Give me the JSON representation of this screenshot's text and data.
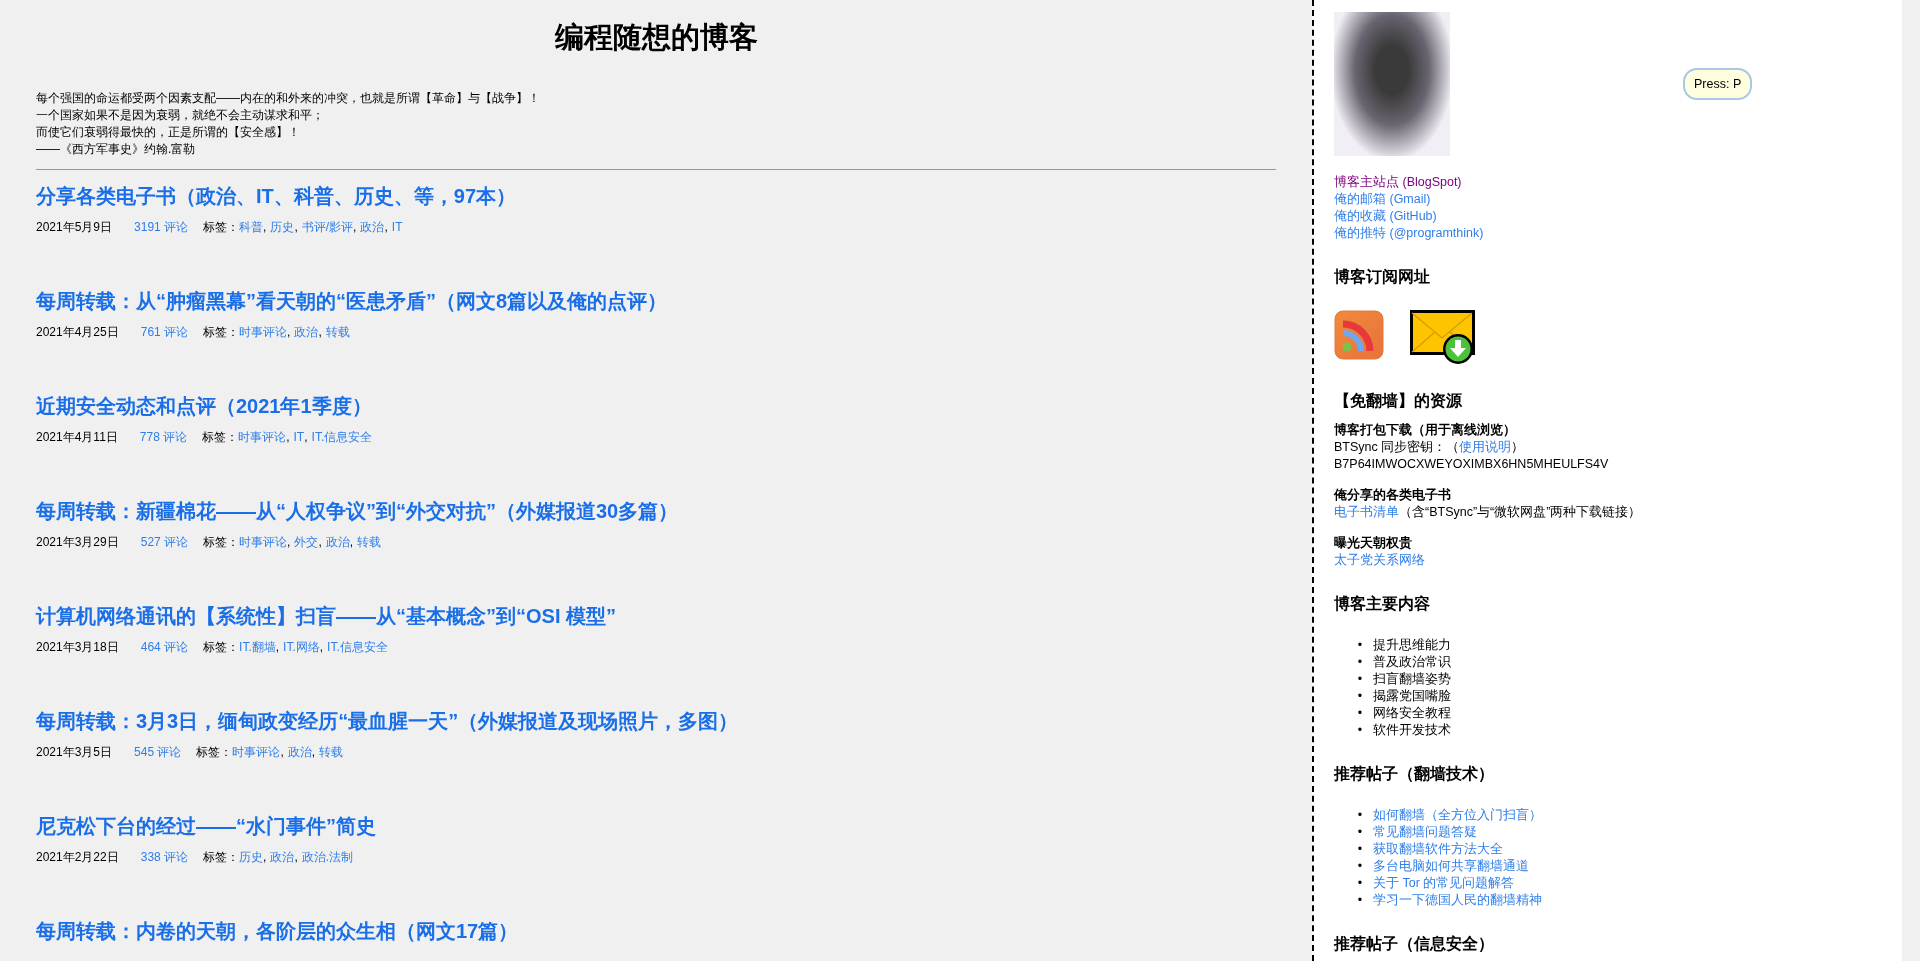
{
  "header": {
    "title": "编程随想的博客",
    "quote_lines": [
      "每个强国的命运都受两个因素支配——内在的和外来的冲突，也就是所谓【革命】与【战争】！",
      "一个国家如果不是因为衰弱，就绝不会主动谋求和平；",
      "而使它们衰弱得最快的，正是所谓的【安全感】！",
      "——《西方军事史》约翰.富勒"
    ]
  },
  "tag_separator": ",",
  "posts": [
    {
      "title": "分享各类电子书（政治、IT、科普、历史、等，97本）",
      "date": "2021年5月9日",
      "comments": "3191 评论",
      "tags_label": "标签：",
      "tags": [
        "科普",
        "历史",
        "书评/影评",
        "政治",
        "IT"
      ]
    },
    {
      "title": "每周转载：从“肿瘤黑幕”看天朝的“医患矛盾”（网文8篇以及俺的点评）",
      "date": "2021年4月25日",
      "comments": "761 评论",
      "tags_label": "标签：",
      "tags": [
        "时事评论",
        "政治",
        "转载"
      ]
    },
    {
      "title": "近期安全动态和点评（2021年1季度）",
      "date": "2021年4月11日",
      "comments": "778 评论",
      "tags_label": "标签：",
      "tags": [
        "时事评论",
        "IT",
        "IT.信息安全"
      ]
    },
    {
      "title": "每周转载：新疆棉花——从“人权争议”到“外交对抗”（外媒报道30多篇）",
      "date": "2021年3月29日",
      "comments": "527 评论",
      "tags_label": "标签：",
      "tags": [
        "时事评论",
        "外交",
        "政治",
        "转载"
      ]
    },
    {
      "title": "计算机网络通讯的【系统性】扫盲——从“基本概念”到“OSI 模型”",
      "date": "2021年3月18日",
      "comments": "464 评论",
      "tags_label": "标签：",
      "tags": [
        "IT.翻墙",
        "IT.网络",
        "IT.信息安全"
      ]
    },
    {
      "title": "每周转载：3月3日，缅甸政变经历“最血腥一天”（外媒报道及现场照片，多图）",
      "date": "2021年3月5日",
      "comments": "545 评论",
      "tags_label": "标签：",
      "tags": [
        "时事评论",
        "政治",
        "转载"
      ]
    },
    {
      "title": "尼克松下台的经过——“水门事件”简史",
      "date": "2021年2月22日",
      "comments": "338 评论",
      "tags_label": "标签：",
      "tags": [
        "历史",
        "政治",
        "政治.法制"
      ]
    },
    {
      "title": "每周转载：内卷的天朝，各阶层的众生相（网文17篇）"
    }
  ],
  "tooltip": {
    "text": "Press: P"
  },
  "sidebar": {
    "links": [
      {
        "text": "博客主站点 (BlogSpot)",
        "visited": true
      },
      {
        "text": "俺的邮箱 (Gmail)",
        "visited": false
      },
      {
        "text": "俺的收藏 (GitHub)",
        "visited": false
      },
      {
        "text": "俺的推特 (@programthink)",
        "visited": false
      }
    ],
    "sections": [
      {
        "kind": "icons",
        "heading": "博客订阅网址",
        "icons": [
          {
            "kind": "rss"
          },
          {
            "kind": "mail"
          }
        ]
      },
      {
        "kind": "resources",
        "heading": "【免翻墙】的资源",
        "blocks": [
          {
            "heading": "博客打包下载（用于离线浏览）",
            "lines": [
              [
                {
                  "text": "BTSync 同步密钥：（",
                  "link": false
                },
                {
                  "text": "使用说明",
                  "link": true
                },
                {
                  "text": "）",
                  "link": false
                }
              ],
              [
                {
                  "text": "B7P64IMWOCXWEYOXIMBX6HN5MHEULFS4V",
                  "link": false
                }
              ]
            ]
          },
          {
            "heading": "俺分享的各类电子书",
            "lines": [
              [
                {
                  "text": "电子书清单",
                  "link": true
                },
                {
                  "text": "（含“BTSync”与“微软网盘”两种下载链接）",
                  "link": false
                }
              ]
            ]
          },
          {
            "heading": "曝光天朝权贵",
            "lines": [
              [
                {
                  "text": "太子党关系网络",
                  "link": true
                }
              ]
            ]
          }
        ]
      },
      {
        "kind": "list",
        "heading": "博客主要内容",
        "bullet": "•",
        "items": [
          {
            "text": "提升思维能力",
            "link": false
          },
          {
            "text": "普及政治常识",
            "link": false
          },
          {
            "text": "扫盲翻墙姿势",
            "link": false
          },
          {
            "text": "揭露党国嘴脸",
            "link": false
          },
          {
            "text": "网络安全教程",
            "link": false
          },
          {
            "text": "软件开发技术",
            "link": false
          }
        ]
      },
      {
        "kind": "list",
        "heading": "推荐帖子（翻墙技术）",
        "bullet": "•",
        "items": [
          {
            "text": "如何翻墙（全方位入门扫盲）",
            "link": true
          },
          {
            "text": "常见翻墙问题答疑",
            "link": true
          },
          {
            "text": "获取翻墙软件方法大全",
            "link": true
          },
          {
            "text": "多台电脑如何共享翻墙通道",
            "link": true
          },
          {
            "text": "关于 Tor 的常见问题解答",
            "link": true
          },
          {
            "text": "学习一下德国人民的翻墙精神",
            "link": true
          }
        ]
      },
      {
        "kind": "list",
        "heading": "推荐帖子（信息安全）"
      }
    ]
  }
}
